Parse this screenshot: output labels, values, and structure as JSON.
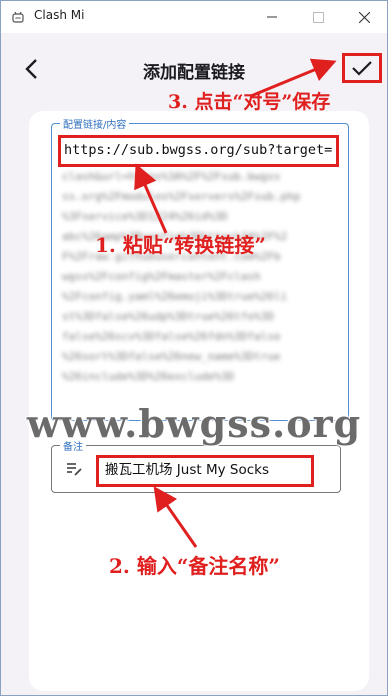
{
  "window": {
    "title": "Clash Mi",
    "controls": [
      "minimize",
      "maximize",
      "close"
    ]
  },
  "appbar": {
    "title": "添加配置链接",
    "back_icon": "chevron-left-icon",
    "confirm_icon": "check-icon"
  },
  "content_field": {
    "label": "配置链接/内容",
    "url": "https://sub.bwgss.org/sub?target=",
    "blurred_lines": [
      "clash&url=https%3A%2F%2Fsub.bwgss",
      "ss.org%2Fmodules%2Fservers%2Fsub.php",
      "%3Fservice%3D1224%26id%3D",
      "abc%26amp%3Bconfig%3Dhttps%3A%2F%2",
      "F%2Fraw.githubusercontent.com%2Fb",
      "wgss%2Fconfig%2Fmaster%2Fclash",
      "%2Fconfig.yaml%26emoji%3Dtrue%26li",
      "st%3Dfalse%26udp%3Dtrue%26tfo%3D",
      "false%26scv%3Dfalse%26fdn%3Dfalse",
      "%26sort%3Dfalse%26new_name%3Dtrue",
      "%26include%3D%26exclude%3D"
    ]
  },
  "notes_field": {
    "label": "备注",
    "value": "搬瓦工机场 Just My Socks",
    "icon": "notes-icon"
  },
  "watermark": "www.bwgss.org",
  "annotations": {
    "step1": "1. 粘贴“转换链接”",
    "step2": "2. 输入“备注名称”",
    "step3": "3. 点击“对号”保存"
  },
  "colors": {
    "annotation": "#e01f1f",
    "field_border": "#4a8fd8",
    "background": "#f4f2f7"
  }
}
